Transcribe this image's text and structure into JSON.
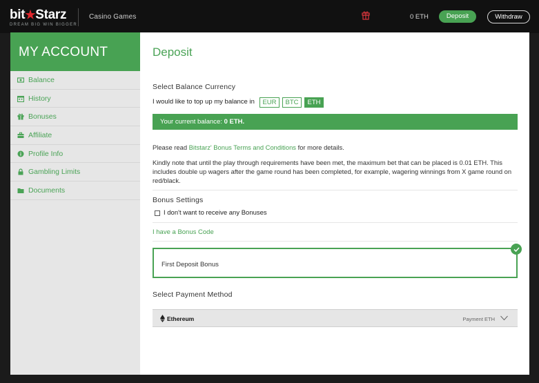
{
  "header": {
    "logo_text_left": "bit",
    "logo_star": "★",
    "logo_text_right": "Starz",
    "logo_tagline": "DREAM BIG  WIN BIGGER",
    "nav_casino": "Casino Games",
    "gift_icon": "gift-icon",
    "balance": "0 ETH",
    "deposit_label": "Deposit",
    "withdraw_label": "Withdraw"
  },
  "sidebar": {
    "title": "MY ACCOUNT",
    "items": [
      {
        "label": "Balance",
        "icon": "money-icon"
      },
      {
        "label": "History",
        "icon": "calendar-icon"
      },
      {
        "label": "Bonuses",
        "icon": "gift-icon"
      },
      {
        "label": "Affiliate",
        "icon": "briefcase-icon"
      },
      {
        "label": "Profile Info",
        "icon": "info-icon"
      },
      {
        "label": "Gambling Limits",
        "icon": "lock-icon"
      },
      {
        "label": "Documents",
        "icon": "folder-icon"
      }
    ]
  },
  "main": {
    "title": "Deposit",
    "currency_section_title": "Select Balance Currency",
    "topup_text": "I would like to top up my balance in",
    "currencies": [
      "EUR",
      "BTC",
      "ETH"
    ],
    "selected_currency": "ETH",
    "balance_prefix": "Your current balance: ",
    "balance_value": "0 ETH",
    "balance_suffix": ".",
    "terms_prefix": "Please read ",
    "terms_link": "Bitstarz' Bonus Terms and Conditions",
    "terms_suffix": " for more details.",
    "note": "Kindly note that until the play through requirements have been met, the maximum bet that can be placed is 0.01 ETH. This includes double up wagers after the game round has been completed, for example, wagering winnings from X game round on red/black.",
    "bonus_settings_title": "Bonus Settings",
    "no_bonus_label": "I don't want to receive any Bonuses",
    "no_bonus_checked": false,
    "bonus_code_link": "I have a Bonus Code",
    "bonus_option_label": "First Deposit Bonus",
    "bonus_option_selected": true,
    "payment_section_title": "Select Payment Method",
    "payment_method_name": "Ethereum",
    "payment_method_caption": "Payment ETH"
  },
  "colors": {
    "accent": "#48a253",
    "topbar": "#111111",
    "background": "#1b1b1b",
    "sidebar_bg": "#e6e6e6",
    "logo_star": "#e0262c"
  }
}
